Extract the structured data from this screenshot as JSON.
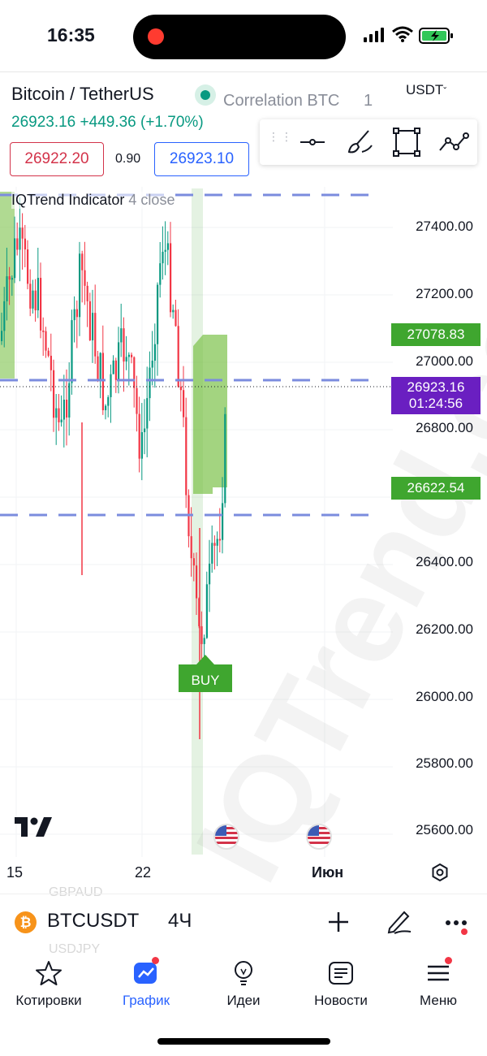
{
  "status": {
    "time": "16:35"
  },
  "header": {
    "symbol_title": "Bitcoin / TetherUS",
    "correlation_label": "Correlation BTC",
    "correlation_value": "1",
    "currency": "USDT",
    "last_price": "26923.16",
    "change": "+449.36",
    "change_pct": "(+1.70%)",
    "sell_price": "26922.20",
    "spread": "0.90",
    "buy_price": "26923.10"
  },
  "drawing_toolbar": {
    "tools": [
      "horizontal-line-icon",
      "brush-icon",
      "rectangle-icon",
      "trend-line-icon"
    ]
  },
  "chart": {
    "indicator_name": "IQTrend Indicator",
    "indicator_params": "4 close",
    "watermark": "IQTrend.com",
    "y_axis_labels": [
      "27400.00",
      "27200.00",
      "27000.00",
      "26800.00",
      "26400.00",
      "26200.00",
      "26000.00",
      "25800.00",
      "25600.00"
    ],
    "price_tags": {
      "upper_band": "26622.54",
      "current_price": "26923.16",
      "countdown": "01:24:56",
      "target": "27078.83"
    },
    "signal_label": "BUY",
    "x_axis_labels": [
      "15",
      "22",
      "Июн"
    ],
    "ghost_symbols": [
      "GBPAUD",
      "USDJPY"
    ]
  },
  "symbol_bar": {
    "symbol": "BTCUSDT",
    "interval": "4Ч"
  },
  "tabs": [
    {
      "label": "Котировки",
      "icon": "star-icon"
    },
    {
      "label": "График",
      "icon": "chart-icon"
    },
    {
      "label": "Идеи",
      "icon": "lightbulb-icon"
    },
    {
      "label": "Новости",
      "icon": "news-icon"
    },
    {
      "label": "Меню",
      "icon": "menu-icon"
    }
  ],
  "colors": {
    "up": "#089981",
    "down": "#f23645",
    "accent": "#2962ff",
    "signal": "#3fa62f",
    "price_tag": "#6a1fc1"
  }
}
